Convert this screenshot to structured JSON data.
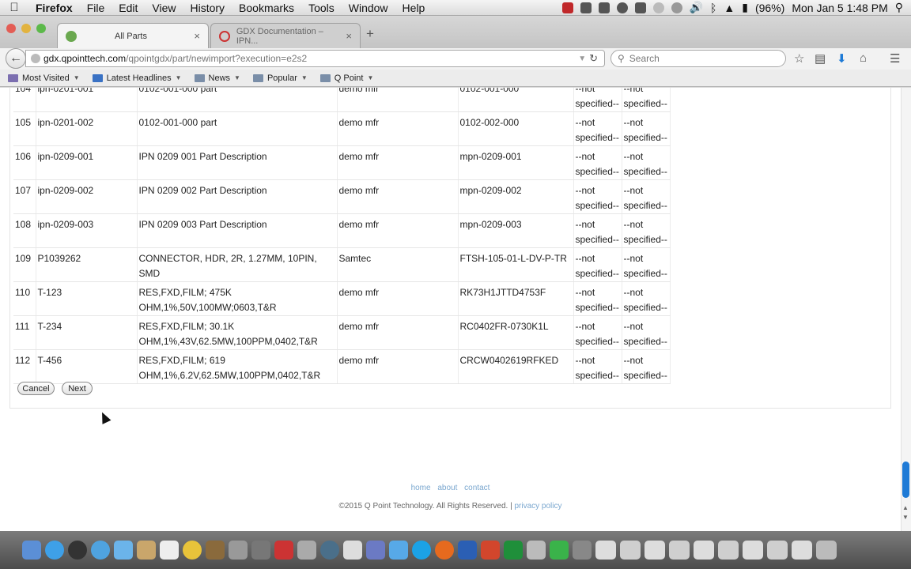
{
  "menubar": {
    "app": "Firefox",
    "items": [
      "File",
      "Edit",
      "View",
      "History",
      "Bookmarks",
      "Tools",
      "Window",
      "Help"
    ],
    "battery": "(96%)",
    "clock": "Mon Jan 5  1:48 PM"
  },
  "tabs": [
    {
      "title": "All Parts",
      "close": "×"
    },
    {
      "title": "GDX Documentation – IPN...",
      "close": "×"
    }
  ],
  "new_tab": "+",
  "url": {
    "host": "gdx.qpointtech.com",
    "path": "/qpointgdx/part/newimport?execution=e2s2"
  },
  "search": {
    "placeholder": "Search"
  },
  "bookmarks": [
    "Most Visited",
    "Latest Headlines",
    "News",
    "Popular",
    "Q Point"
  ],
  "rows": [
    [
      "104",
      "ipn-0201-001",
      "0102-001-000 part",
      "demo mfr",
      "0102-001-000",
      "--not specified--",
      "--not specified--"
    ],
    [
      "105",
      "ipn-0201-002",
      "0102-001-000 part",
      "demo mfr",
      "0102-002-000",
      "--not specified--",
      "--not specified--"
    ],
    [
      "106",
      "ipn-0209-001",
      "IPN 0209 001 Part Description",
      "demo mfr",
      "mpn-0209-001",
      "--not specified--",
      "--not specified--"
    ],
    [
      "107",
      "ipn-0209-002",
      "IPN 0209 002 Part Description",
      "demo mfr",
      "mpn-0209-002",
      "--not specified--",
      "--not specified--"
    ],
    [
      "108",
      "ipn-0209-003",
      "IPN 0209 003 Part Description",
      "demo mfr",
      "mpn-0209-003",
      "--not specified--",
      "--not specified--"
    ],
    [
      "109",
      "P1039262",
      "CONNECTOR, HDR, 2R, 1.27MM, 10PIN, SMD",
      "Samtec",
      "FTSH-105-01-L-DV-P-TR",
      "--not specified--",
      "--not specified--"
    ],
    [
      "110",
      "T-123",
      "RES,FXD,FILM; 475K OHM,1%,50V,100MW;0603,T&R",
      "demo mfr",
      "RK73H1JTTD4753F",
      "--not specified--",
      "--not specified--"
    ],
    [
      "111",
      "T-234",
      "RES,FXD,FILM; 30.1K OHM,1%,43V,62.5MW,100PPM,0402,T&R",
      "demo mfr",
      "RC0402FR-0730K1L",
      "--not specified--",
      "--not specified--"
    ],
    [
      "112",
      "T-456",
      "RES,FXD,FILM; 619 OHM,1%,6.2V,62.5MW,100PPM,0402,T&R",
      "demo mfr",
      "CRCW0402619RFKED",
      "--not specified--",
      "--not specified--"
    ]
  ],
  "buttons": {
    "cancel": "Cancel",
    "next": "Next"
  },
  "footer": {
    "links": [
      "home",
      "about",
      "contact"
    ],
    "copyright": "©2015 Q Point Technology. All Rights Reserved. |",
    "privacy": "privacy policy"
  }
}
